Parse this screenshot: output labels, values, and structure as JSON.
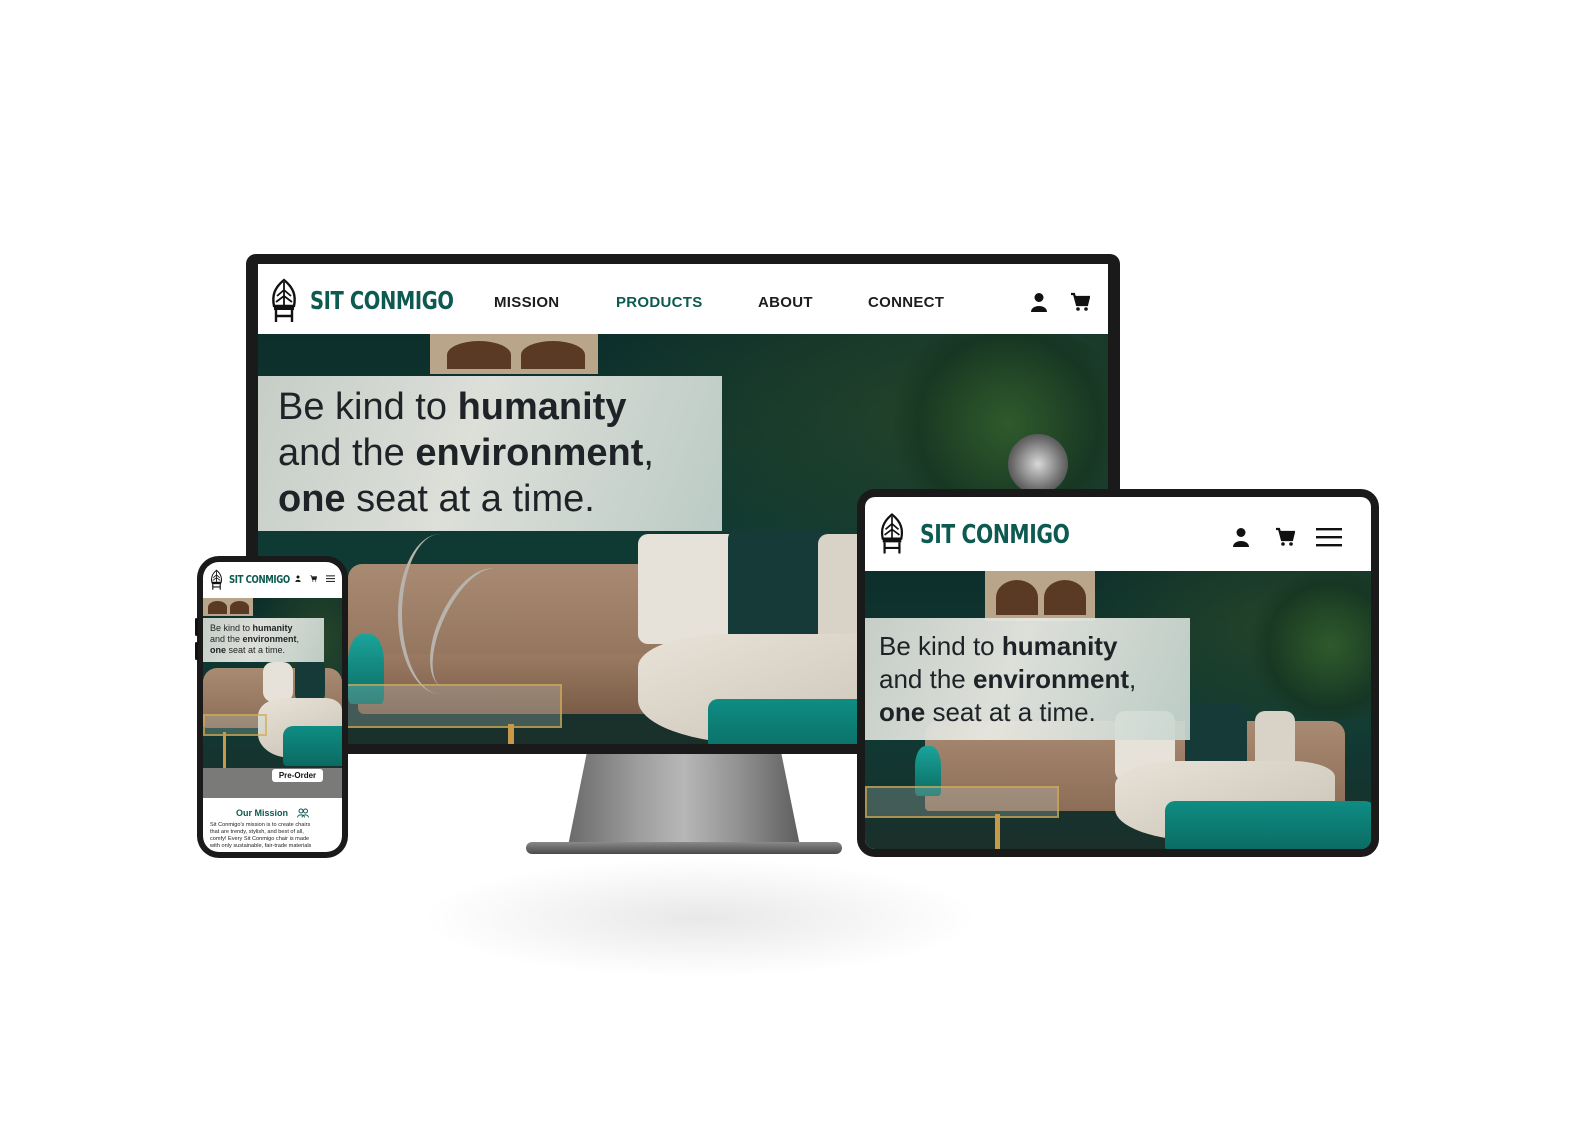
{
  "brand": {
    "name": "SIT CONMIGO",
    "accent_color": "#0d5a50",
    "text_color": "#1d1d1d"
  },
  "desktop": {
    "nav": {
      "items": [
        {
          "label": "MISSION",
          "active": false
        },
        {
          "label": "PRODUCTS",
          "active": true
        },
        {
          "label": "ABOUT",
          "active": false
        },
        {
          "label": "CONNECT",
          "active": false
        }
      ],
      "icons": [
        "user-icon",
        "cart-icon"
      ]
    },
    "hero": {
      "line1_a": "Be kind to ",
      "line1_b": "humanity",
      "line2_a": "and the ",
      "line2_b": "environment",
      "line2_c": ",",
      "line3_a": "one",
      "line3_b": " seat at a time."
    }
  },
  "tablet": {
    "icons": [
      "user-icon",
      "cart-icon",
      "menu-icon"
    ],
    "hero": {
      "line1_a": "Be kind to ",
      "line1_b": "humanity",
      "line2_a": "and the ",
      "line2_b": "environment",
      "line2_c": ",",
      "line3_a": "one",
      "line3_b": " seat at a time."
    }
  },
  "phone": {
    "icons": [
      "user-icon",
      "cart-icon",
      "menu-icon"
    ],
    "hero": {
      "line1_a": "Be kind to ",
      "line1_b": "humanity",
      "line2_a": "and the ",
      "line2_b": "environment",
      "line2_c": ",",
      "line3_a": "one",
      "line3_b": " seat at a time."
    },
    "cta_label": "Pre-Order",
    "mission": {
      "title": "Our Mission",
      "icon": "people-icon",
      "text_lines": [
        "Sit Conmigo's mission is to create chairs",
        "that are trendy, stylish, and best of all,",
        "comfy! Every Sit Conmigo chair is made",
        "with only sustainable, fair-trade materials"
      ]
    }
  }
}
